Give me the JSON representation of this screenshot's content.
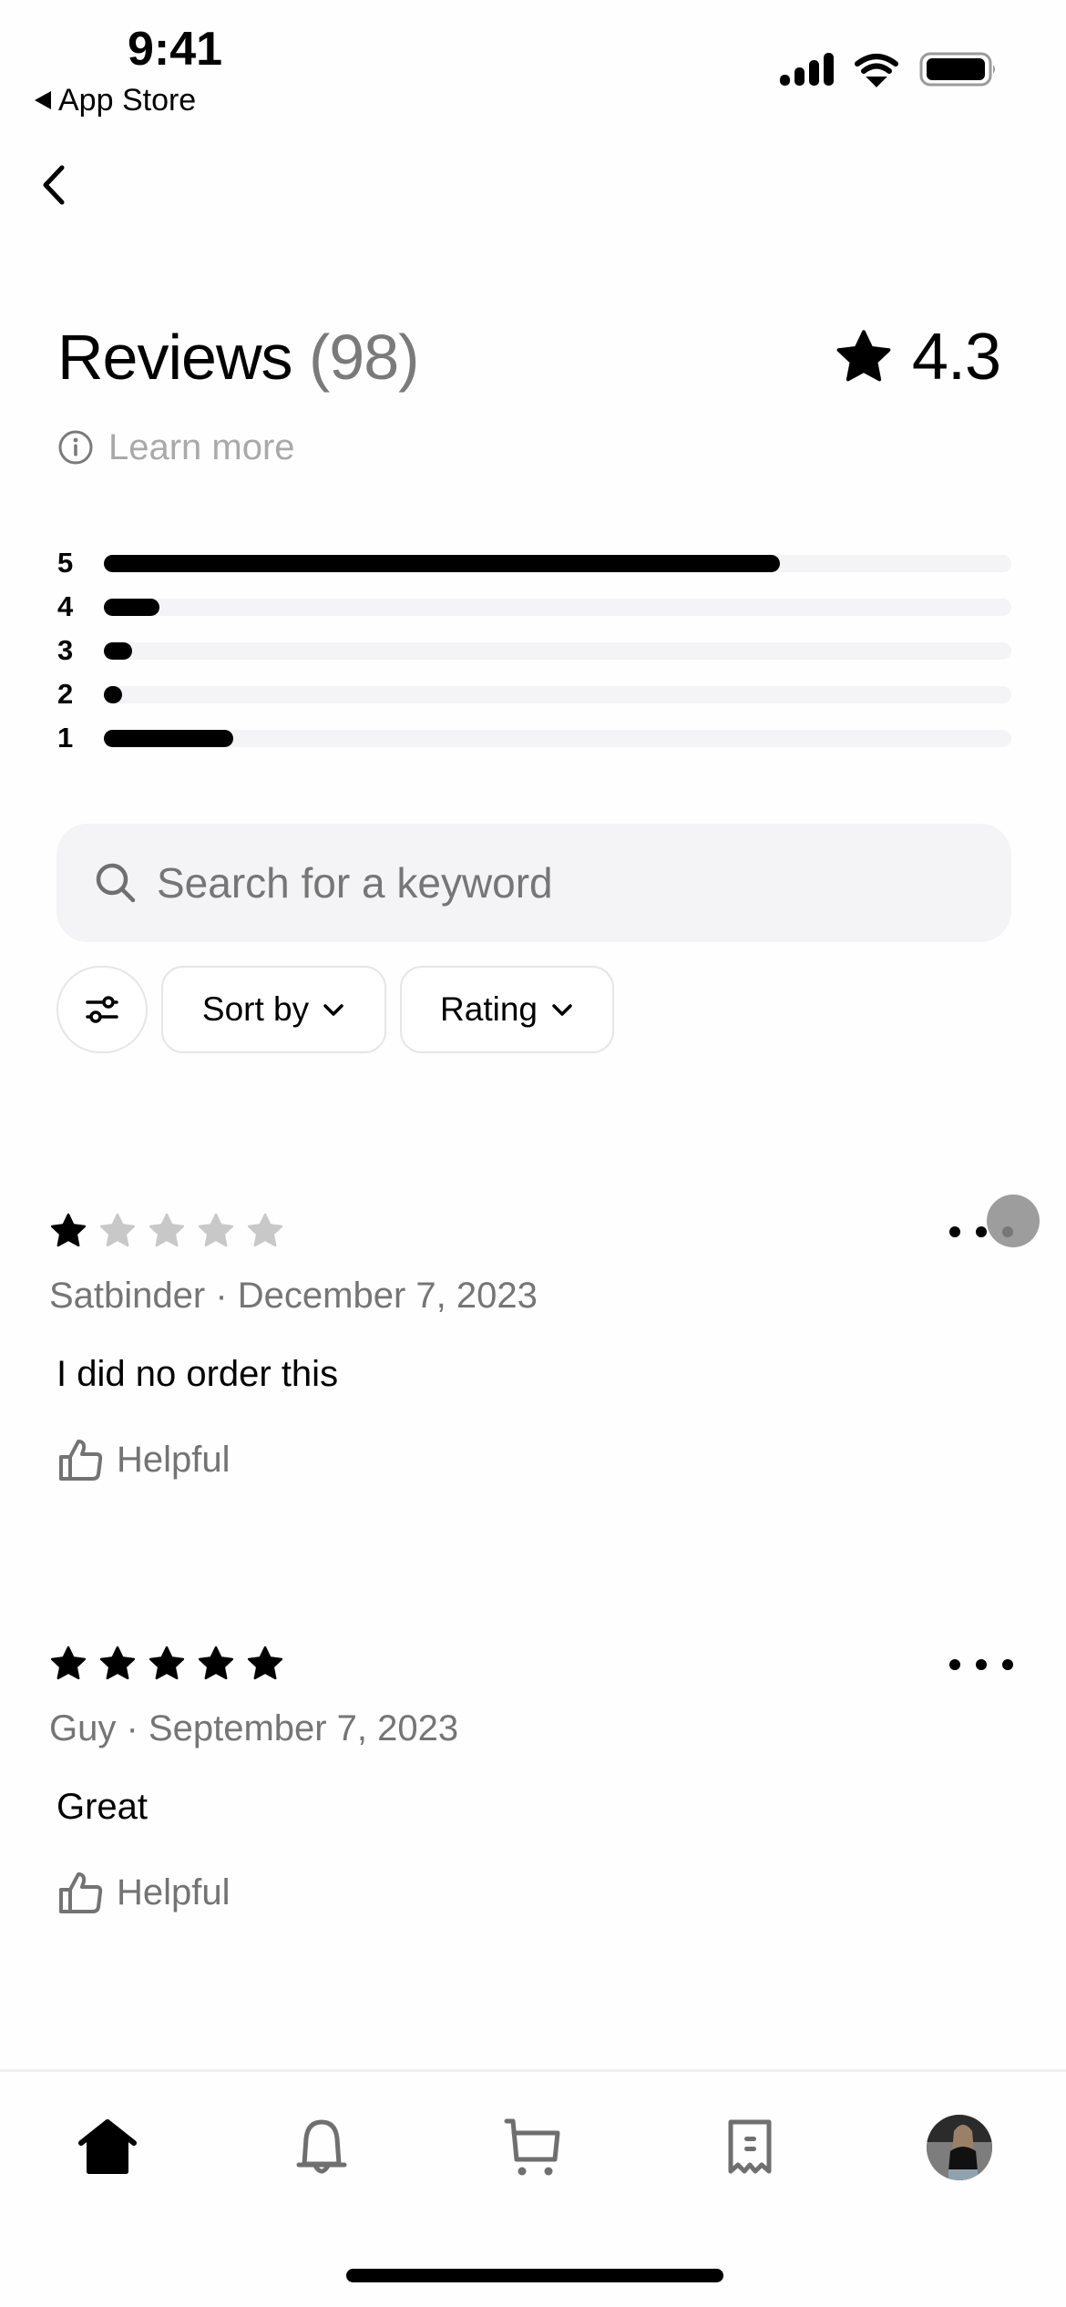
{
  "status_bar": {
    "time": "9:41",
    "back_app": "App Store",
    "icons": [
      "cellular-signal-icon",
      "wifi-icon",
      "battery-icon"
    ]
  },
  "nav": {
    "back_icon": "chevron-left-icon"
  },
  "header": {
    "title": "Reviews",
    "count": "(98)",
    "average_rating": "4.3",
    "rating_icon": "star-icon",
    "learn_more": "Learn more",
    "learn_more_icon": "info-icon"
  },
  "histogram": {
    "total_reviews": 98,
    "rows": [
      {
        "label": "5",
        "count": 73,
        "fraction": 0.745
      },
      {
        "label": "4",
        "count": 6,
        "fraction": 0.061
      },
      {
        "label": "3",
        "count": 3,
        "fraction": 0.031
      },
      {
        "label": "2",
        "count": 2,
        "fraction": 0.02
      },
      {
        "label": "1",
        "count": 14,
        "fraction": 0.143
      }
    ]
  },
  "search": {
    "placeholder": "Search for a keyword",
    "value": "",
    "icon": "search-icon"
  },
  "filters": {
    "filter_icon": "sliders-icon",
    "sort_label": "Sort by",
    "rating_label": "Rating",
    "chevron_icon": "chevron-down-icon"
  },
  "reviews": [
    {
      "rating": 1,
      "max_rating": 5,
      "author": "Satbinder",
      "date": "December 7, 2023",
      "byline": "Satbinder · December 7, 2023",
      "text": "I did no order this",
      "helpful_label": "Helpful",
      "more_icon": "more-horizontal-icon"
    },
    {
      "rating": 5,
      "max_rating": 5,
      "author": "Guy",
      "date": "September 7, 2023",
      "byline": "Guy · September 7, 2023",
      "text": "Great",
      "helpful_label": "Helpful",
      "more_icon": "more-horizontal-icon"
    }
  ],
  "tab_bar": {
    "tabs": [
      {
        "name": "home",
        "icon": "home-icon",
        "active": true
      },
      {
        "name": "notifications",
        "icon": "bell-icon",
        "active": false
      },
      {
        "name": "cart",
        "icon": "cart-icon",
        "active": false
      },
      {
        "name": "orders",
        "icon": "receipt-icon",
        "active": false
      },
      {
        "name": "profile",
        "icon": "avatar",
        "active": false
      }
    ]
  },
  "colors": {
    "text_primary": "#000000",
    "text_secondary": "#757575",
    "text_muted": "#a9a9a9",
    "star_filled": "#000000",
    "star_empty": "#c8c8c8",
    "track": "#f4f4f6",
    "icon_inactive": "#6f6f6f"
  }
}
